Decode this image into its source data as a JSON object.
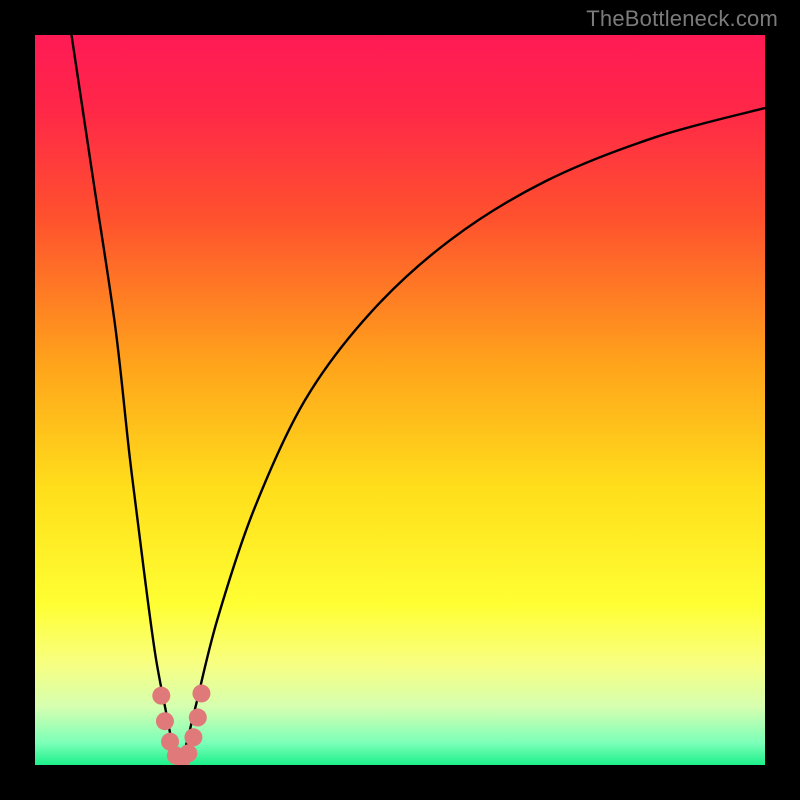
{
  "watermark": "TheBottleneck.com",
  "gradient_stops": [
    {
      "offset": 0.0,
      "color": "#ff1a55"
    },
    {
      "offset": 0.1,
      "color": "#ff2748"
    },
    {
      "offset": 0.25,
      "color": "#ff512e"
    },
    {
      "offset": 0.45,
      "color": "#ffa31b"
    },
    {
      "offset": 0.62,
      "color": "#ffde1b"
    },
    {
      "offset": 0.78,
      "color": "#ffff33"
    },
    {
      "offset": 0.86,
      "color": "#f8ff80"
    },
    {
      "offset": 0.92,
      "color": "#d6ffb0"
    },
    {
      "offset": 0.97,
      "color": "#7bffb8"
    },
    {
      "offset": 1.0,
      "color": "#1cf08a"
    }
  ],
  "chart_data": {
    "type": "line",
    "title": "",
    "xlabel": "",
    "ylabel": "",
    "xlim": [
      0,
      100
    ],
    "ylim": [
      0,
      100
    ],
    "series": [
      {
        "name": "bottleneck-curve-left",
        "x": [
          5,
          8,
          11,
          13,
          15,
          16.5,
          18,
          19,
          19.7
        ],
        "values": [
          100,
          80,
          60,
          42,
          26,
          15,
          7,
          2,
          0
        ]
      },
      {
        "name": "bottleneck-curve-right",
        "x": [
          19.7,
          20.5,
          22,
          25,
          30,
          37,
          46,
          57,
          70,
          85,
          100
        ],
        "values": [
          0,
          2,
          8,
          20,
          35,
          50,
          62,
          72,
          80,
          86,
          90
        ]
      },
      {
        "name": "valley-marker-dots",
        "x": [
          17.3,
          17.8,
          18.5,
          19.3,
          20.1,
          21.0,
          21.7,
          22.3,
          22.8
        ],
        "values": [
          9.5,
          6.0,
          3.2,
          1.3,
          0.8,
          1.6,
          3.8,
          6.5,
          9.8
        ]
      }
    ],
    "marker_color": "#e07a7a",
    "curve_color": "#000000"
  }
}
